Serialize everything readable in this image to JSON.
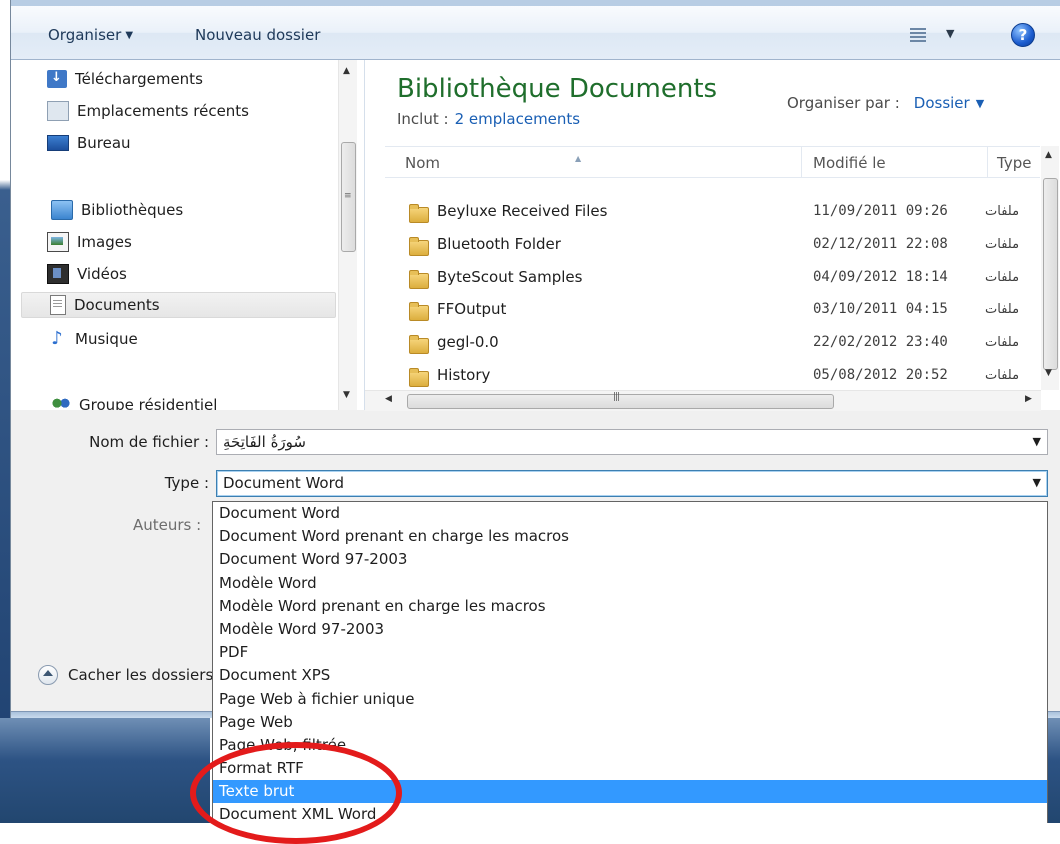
{
  "toolbar": {
    "organize": "Organiser",
    "new_folder": "Nouveau dossier",
    "help": "?"
  },
  "nav": {
    "items": [
      {
        "label": "Téléchargements"
      },
      {
        "label": "Emplacements récents"
      },
      {
        "label": "Bureau"
      },
      {
        "label": "Bibliothèques"
      },
      {
        "label": "Images"
      },
      {
        "label": "Vidéos"
      },
      {
        "label": "Documents"
      },
      {
        "label": "Musique"
      },
      {
        "label": "Groupe résidentiel"
      }
    ]
  },
  "library": {
    "title": "Bibliothèque Documents",
    "includes_label": "Inclut :",
    "includes_link": "2 emplacements",
    "arrange_label": "Organiser par :",
    "arrange_value": "Dossier"
  },
  "columns": {
    "name": "Nom",
    "modified": "Modifié le",
    "type": "Type"
  },
  "files": [
    {
      "name": "Beyluxe Received Files",
      "date": "11/09/2011 09:26",
      "type": "ملفات"
    },
    {
      "name": "Bluetooth Folder",
      "date": "02/12/2011 22:08",
      "type": "ملفات"
    },
    {
      "name": "ByteScout Samples",
      "date": "04/09/2012 18:14",
      "type": "ملفات"
    },
    {
      "name": "FFOutput",
      "date": "03/10/2011 04:15",
      "type": "ملفات"
    },
    {
      "name": "gegl-0.0",
      "date": "22/02/2012 23:40",
      "type": "ملفات"
    },
    {
      "name": "History",
      "date": "05/08/2012 20:52",
      "type": "ملفات"
    }
  ],
  "form": {
    "filename_label": "Nom de fichier :",
    "filename_value": "سُورَةُ الفَاتِحَةِ",
    "type_label": "Type :",
    "type_value": "Document Word",
    "authors_label": "Auteurs :",
    "hide_folders": "Cacher les dossiers"
  },
  "type_options": [
    "Document Word",
    "Document Word prenant en charge les macros",
    "Document Word 97-2003",
    "Modèle Word",
    "Modèle Word prenant en charge les macros",
    "Modèle Word 97-2003",
    "PDF",
    "Document XPS",
    "Page Web à fichier unique",
    "Page Web",
    "Page Web, filtrée",
    "Format RTF",
    "Texte brut",
    "Document XML Word"
  ],
  "highlighted_option": "Texte brut",
  "colors": {
    "accent": "#3399ff",
    "title_green": "#1f6e2c",
    "link_blue": "#1a5fb4",
    "annotation_red": "#e31b1b"
  }
}
